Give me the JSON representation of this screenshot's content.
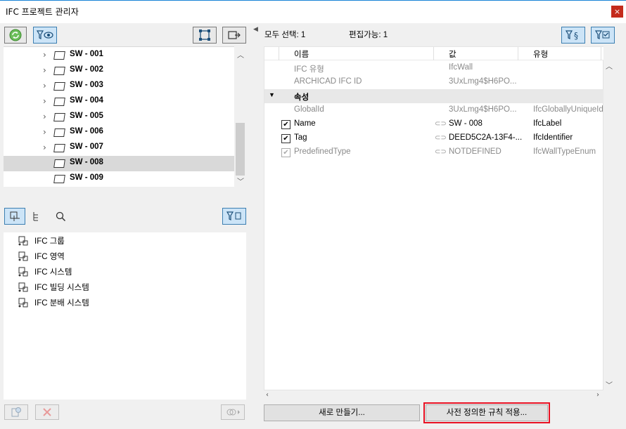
{
  "window": {
    "title": "IFC 프로젝트 관리자",
    "close_glyph": "×"
  },
  "tree": {
    "items": [
      {
        "label": "SW - 001",
        "expandable": true,
        "selected": false
      },
      {
        "label": "SW - 002",
        "expandable": true,
        "selected": false
      },
      {
        "label": "SW - 003",
        "expandable": true,
        "selected": false
      },
      {
        "label": "SW - 004",
        "expandable": true,
        "selected": false
      },
      {
        "label": "SW - 005",
        "expandable": true,
        "selected": false
      },
      {
        "label": "SW - 006",
        "expandable": true,
        "selected": false
      },
      {
        "label": "SW - 007",
        "expandable": true,
        "selected": false
      },
      {
        "label": "SW - 008",
        "expandable": false,
        "selected": true
      },
      {
        "label": "SW - 009",
        "expandable": false,
        "selected": false
      }
    ]
  },
  "classifications": {
    "items": [
      {
        "label": "IFC 그룹",
        "icon": "ifc-group-icon"
      },
      {
        "label": "IFC 영역",
        "icon": "ifc-zone-icon"
      },
      {
        "label": "IFC 시스템",
        "icon": "ifc-system-icon"
      },
      {
        "label": "IFC 빌딩 시스템",
        "icon": "ifc-building-system-icon"
      },
      {
        "label": "IFC 분배 시스템",
        "icon": "ifc-distribution-system-icon"
      }
    ]
  },
  "status": {
    "select_all": "모두 선택: 1",
    "editable": "편집가능: 1"
  },
  "properties": {
    "headers": {
      "name": "이름",
      "value": "값",
      "type": "유형"
    },
    "rows": [
      {
        "name": "IFC 유형",
        "value": "IfcWall",
        "type": "",
        "kind": "readonly"
      },
      {
        "name": "ARCHICAD IFC ID",
        "value": "3UxLmg4$H6PO...",
        "type": "",
        "kind": "readonly"
      },
      {
        "name": "속성",
        "value": "",
        "type": "",
        "kind": "group"
      },
      {
        "name": "GlobalId",
        "value": "3UxLmg4$H6PO...",
        "type": "IfcGloballyUniqueId",
        "kind": "readonly"
      },
      {
        "name": "Name",
        "value": "SW - 008",
        "type": "IfcLabel",
        "kind": "checked"
      },
      {
        "name": "Tag",
        "value": "DEED5C2A-13F4-...",
        "type": "IfcIdentifier",
        "kind": "checked"
      },
      {
        "name": "PredefinedType",
        "value": "NOTDEFINED",
        "type": "IfcWallTypeEnum",
        "kind": "disabled"
      }
    ]
  },
  "buttons": {
    "new": "새로 만들기...",
    "apply_rules": "사전 정의한 규칙 적용..."
  },
  "colors": {
    "accent": "#3c7fb1",
    "highlight": "#e81123",
    "selected_row": "#d9d9d9"
  }
}
